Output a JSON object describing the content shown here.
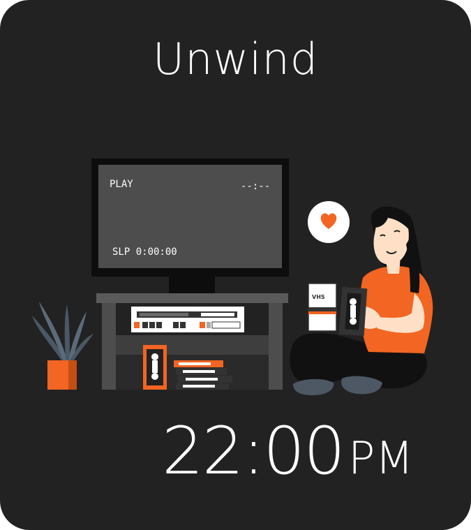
{
  "title": "Unwind",
  "tv": {
    "status": "PLAY",
    "counter": "--:--",
    "speed_time": "SLP 0:00:00"
  },
  "tape": {
    "label": "VHS"
  },
  "clock": {
    "time": "22:00",
    "period": "PM"
  },
  "colors": {
    "background": "#222222",
    "accent": "#f26522",
    "text": "#ffffff",
    "furniture": "#4d4d4d"
  },
  "icons": {
    "reaction": "heart-icon"
  }
}
